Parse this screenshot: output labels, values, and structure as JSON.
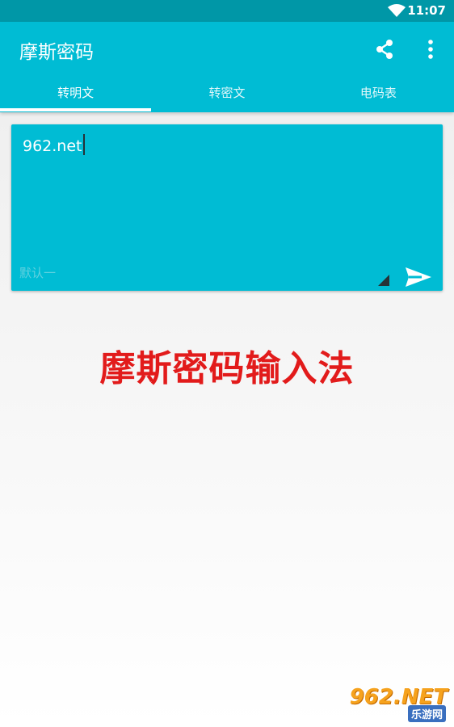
{
  "status_bar": {
    "time": "11:07",
    "icons": [
      "wifi-icon"
    ]
  },
  "app_bar": {
    "title": "摩斯密码",
    "actions": [
      "share-icon",
      "more-vert-icon"
    ]
  },
  "tabs": [
    {
      "label": "转明文",
      "selected": true
    },
    {
      "label": "转密文",
      "selected": false
    },
    {
      "label": "电码表",
      "selected": false
    }
  ],
  "editor": {
    "value": "962.net",
    "hint": "默认一",
    "send_icon": "send-icon"
  },
  "promo_text": "摩斯密码输入法",
  "watermark": {
    "main": "962.NET",
    "sub": "乐游网"
  },
  "colors": {
    "primary": "#00bcd4",
    "primary_dark": "#0097a7",
    "promo_red": "#e21b1b"
  }
}
